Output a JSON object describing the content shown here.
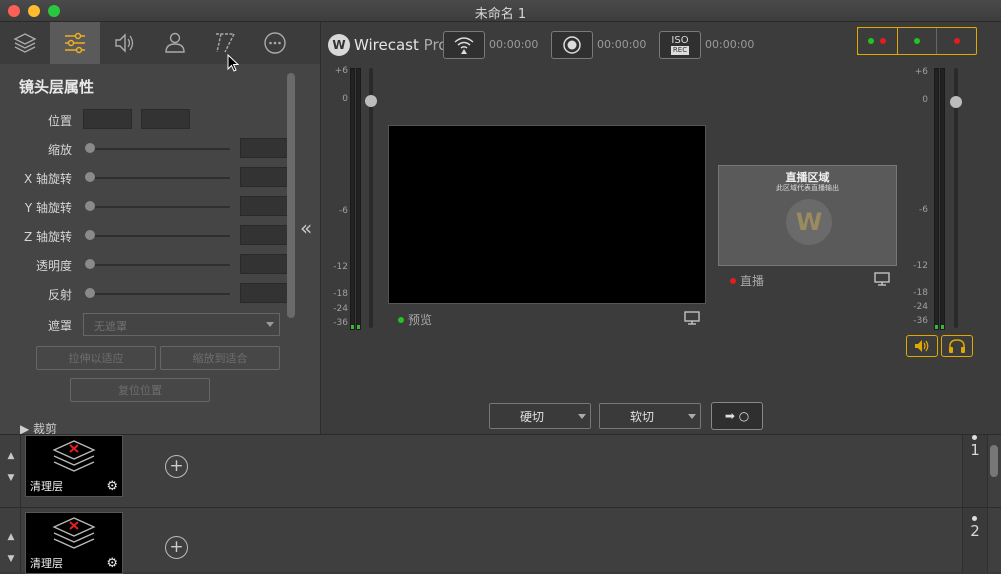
{
  "window": {
    "title": "未命名 1"
  },
  "left_panel": {
    "tabs": [
      {
        "name": "layers",
        "icon": "layers-icon"
      },
      {
        "name": "properties",
        "icon": "sliders-icon",
        "active": true
      },
      {
        "name": "audio",
        "icon": "speaker-icon"
      },
      {
        "name": "people",
        "icon": "person-icon"
      },
      {
        "name": "titles",
        "icon": "titler-icon"
      },
      {
        "name": "more",
        "icon": "more-icon"
      }
    ],
    "section_title": "镜头层属性",
    "rows": {
      "position": "位置",
      "scale": "缩放",
      "x_rotate": "X 轴旋转",
      "y_rotate": "Y 轴旋转",
      "z_rotate": "Z 轴旋转",
      "opacity": "透明度",
      "reflection": "反射",
      "mask": "遮罩"
    },
    "mask_select": "无遮罩",
    "buttons": {
      "stretch_fit": "拉伸以适应",
      "scale_fit": "缩放到适合",
      "reset_position": "复位位置"
    },
    "collapsed_section": "▶ 裁剪"
  },
  "main": {
    "logo": {
      "brand": "Wirecast",
      "edition": "Pro"
    },
    "stream_time": "00:00:00",
    "record_time": "00:00:00",
    "iso_time": "00:00:00",
    "iso_label_top": "ISO",
    "iso_label_bottom": "REC",
    "meter_scale": [
      "+6",
      "0",
      "-6",
      "-12",
      "-18",
      "-24",
      "-36"
    ],
    "preview_label": "预览",
    "live_label": "直播",
    "live_panel": {
      "title": "直播区域",
      "subtitle": "此区域代表直播输出"
    },
    "transitions": {
      "cut": "硬切",
      "smooth": "软切"
    },
    "go_symbol": "➡ ○",
    "status_colors": {
      "green": "#22c422",
      "red": "#e02020",
      "accent": "#e0a800"
    }
  },
  "layers": [
    {
      "number": "1",
      "shot_label": "清理层"
    },
    {
      "number": "2",
      "shot_label": "清理层"
    }
  ]
}
